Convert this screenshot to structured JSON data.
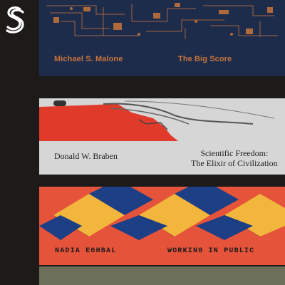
{
  "logo": {
    "icon": "s-logo-icon",
    "color": "#ffffff"
  },
  "books": [
    {
      "author": "Michael S. Malone",
      "title": "The Big Score",
      "cover_color": "#1e2c4c",
      "text_color": "#c8743a"
    },
    {
      "author": "Donald W. Braben",
      "title_line1": "Scientific Freedom:",
      "title_line2": "The Elixir of Civilization",
      "cover_color": "#d6d6d6",
      "accent_color": "#e03a2a"
    },
    {
      "author": "NADIA EGHBAL",
      "title": "WORKING IN PUBLIC",
      "cover_color": "#e4533a",
      "pattern_colors": [
        "#f2b63c",
        "#1c3f86",
        "#e4533a"
      ]
    },
    {
      "cover_color": "#6d7058"
    }
  ]
}
